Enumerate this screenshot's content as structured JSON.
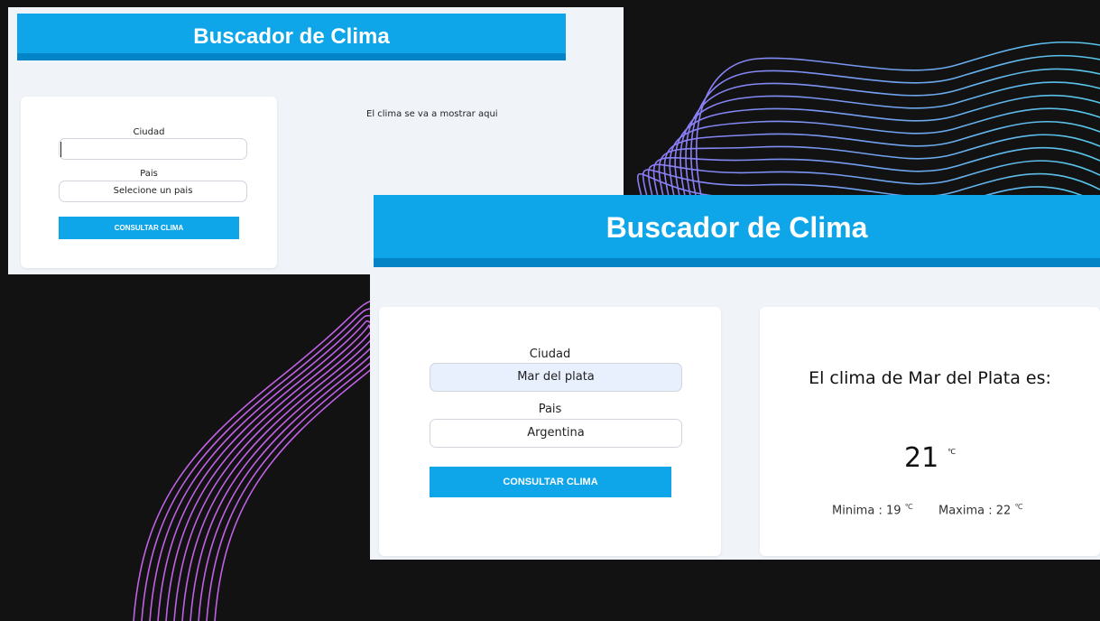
{
  "app": {
    "title": "Buscador de Clima"
  },
  "accent_color": "#0ea5e9",
  "accent_dark_color": "#0284c7",
  "window_initial": {
    "title": "Buscador de Clima",
    "form": {
      "city_label": "Ciudad",
      "city_value": "",
      "country_label": "Pais",
      "country_value": "Selecione un pais",
      "submit_label": "CONSULTAR CLIMA"
    },
    "result_placeholder": "El clima se va a mostrar aqui"
  },
  "window_result": {
    "title": "Buscador de Clima",
    "form": {
      "city_label": "Ciudad",
      "city_value": "Mar del plata",
      "country_label": "Pais",
      "country_value": "Argentina",
      "submit_label": "CONSULTAR CLIMA"
    },
    "result": {
      "title": "El clima de Mar del Plata es:",
      "temp": "21",
      "temp_unit": "℃",
      "min_label": "Minima : 19",
      "min_unit": "℃",
      "max_label": "Maxima : 22",
      "max_unit": "℃"
    }
  }
}
